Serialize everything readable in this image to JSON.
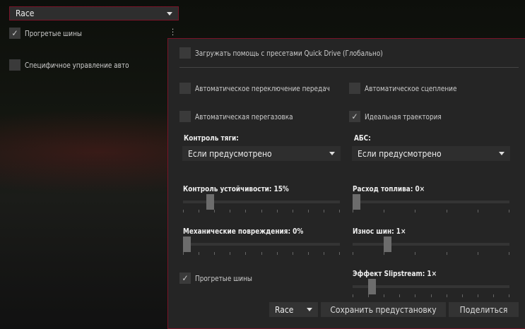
{
  "top": {
    "preset": "Race",
    "warm_tyres": "Прогретые шины",
    "warm_tyres_checked": true,
    "car_specific": "Специфичное управление авто",
    "car_specific_checked": false
  },
  "panel": {
    "load_assists": "Загружать помощь с пресетами Quick Drive (Глобально)",
    "auto_shift": "Автоматическое переключение передач",
    "auto_clutch": "Автоматическое сцепление",
    "auto_blip": "Автоматическая перегазовка",
    "ideal_line": "Идеальная траектория",
    "tc_label": "Контроль тяги:",
    "tc_value": "Если предусмотрено",
    "abs_label": "АБС:",
    "abs_value": "Если предусмотрено",
    "sliders": [
      {
        "label": "Контроль устойчивости: 15%",
        "value": 15,
        "min": 0,
        "max": 100
      },
      {
        "label": "Расход топлива: 0×",
        "value": 0,
        "min": 0,
        "max": 5
      },
      {
        "label": "Механические повреждения: 0%",
        "value": 0,
        "min": 0,
        "max": 100
      },
      {
        "label": "Износ шин: 1×",
        "value": 1,
        "min": 0,
        "max": 5
      },
      {
        "label": "Эффект Slipstream: 1×",
        "value": 1,
        "min": 0,
        "max": 10
      }
    ],
    "warm_tyres": "Прогретые шины",
    "preset": "Race",
    "save": "Сохранить предустановку",
    "share": "Поделиться"
  },
  "colors": {
    "accent": "#7a1428",
    "panel": "#252525"
  }
}
